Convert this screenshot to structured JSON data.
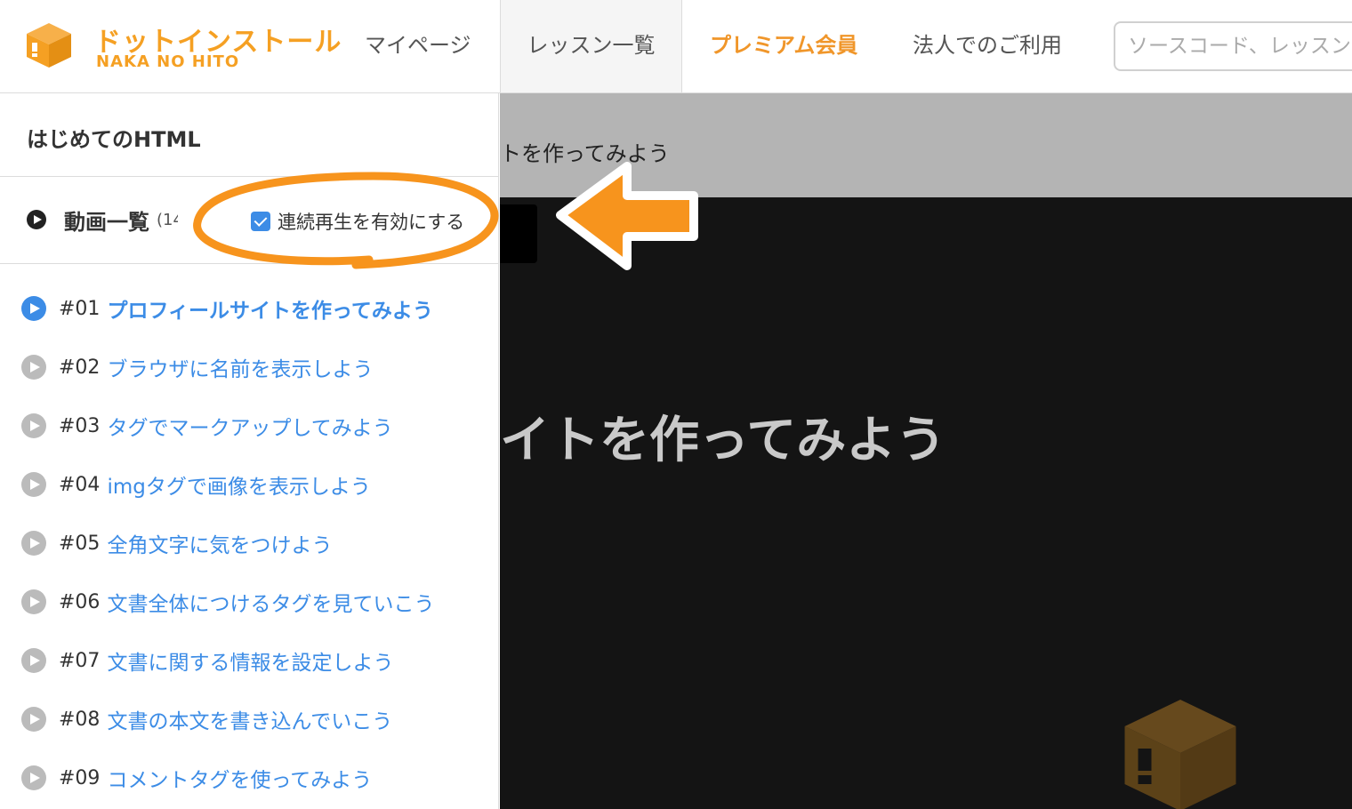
{
  "header": {
    "logo_title": "ドットインストール",
    "logo_sub": "NAKA NO HITO",
    "nav": {
      "mypage": "マイページ",
      "lessons": "レッスン一覧",
      "premium": "プレミアム会員",
      "corporate": "法人でのご利用"
    },
    "search_placeholder": "ソースコード、レッスン"
  },
  "sidebar": {
    "course_title": "はじめてのHTML",
    "video_list_label": "動画一覧",
    "video_list_count": "(14",
    "autoplay_label": "連続再生を有効にする",
    "autoplay_checked": true,
    "lessons": [
      {
        "num": "#01",
        "title": "プロフィールサイトを作ってみよう",
        "active": true
      },
      {
        "num": "#02",
        "title": "ブラウザに名前を表示しよう",
        "active": false
      },
      {
        "num": "#03",
        "title": "タグでマークアップしてみよう",
        "active": false
      },
      {
        "num": "#04",
        "title": "imgタグで画像を表示しよう",
        "active": false
      },
      {
        "num": "#05",
        "title": "全角文字に気をつけよう",
        "active": false
      },
      {
        "num": "#06",
        "title": "文書全体につけるタグを見ていこう",
        "active": false
      },
      {
        "num": "#07",
        "title": "文書に関する情報を設定しよう",
        "active": false
      },
      {
        "num": "#08",
        "title": "文書の本文を書き込んでいこう",
        "active": false
      },
      {
        "num": "#09",
        "title": "コメントタグを使ってみよう",
        "active": false
      }
    ]
  },
  "video": {
    "title_bar_text": "トを作ってみよう",
    "badge_text": "。",
    "caption": "イトを作ってみよう"
  },
  "colors": {
    "brand_orange": "#f5a023",
    "link_blue": "#3c8ce6",
    "annotation_orange": "#f7941d"
  }
}
